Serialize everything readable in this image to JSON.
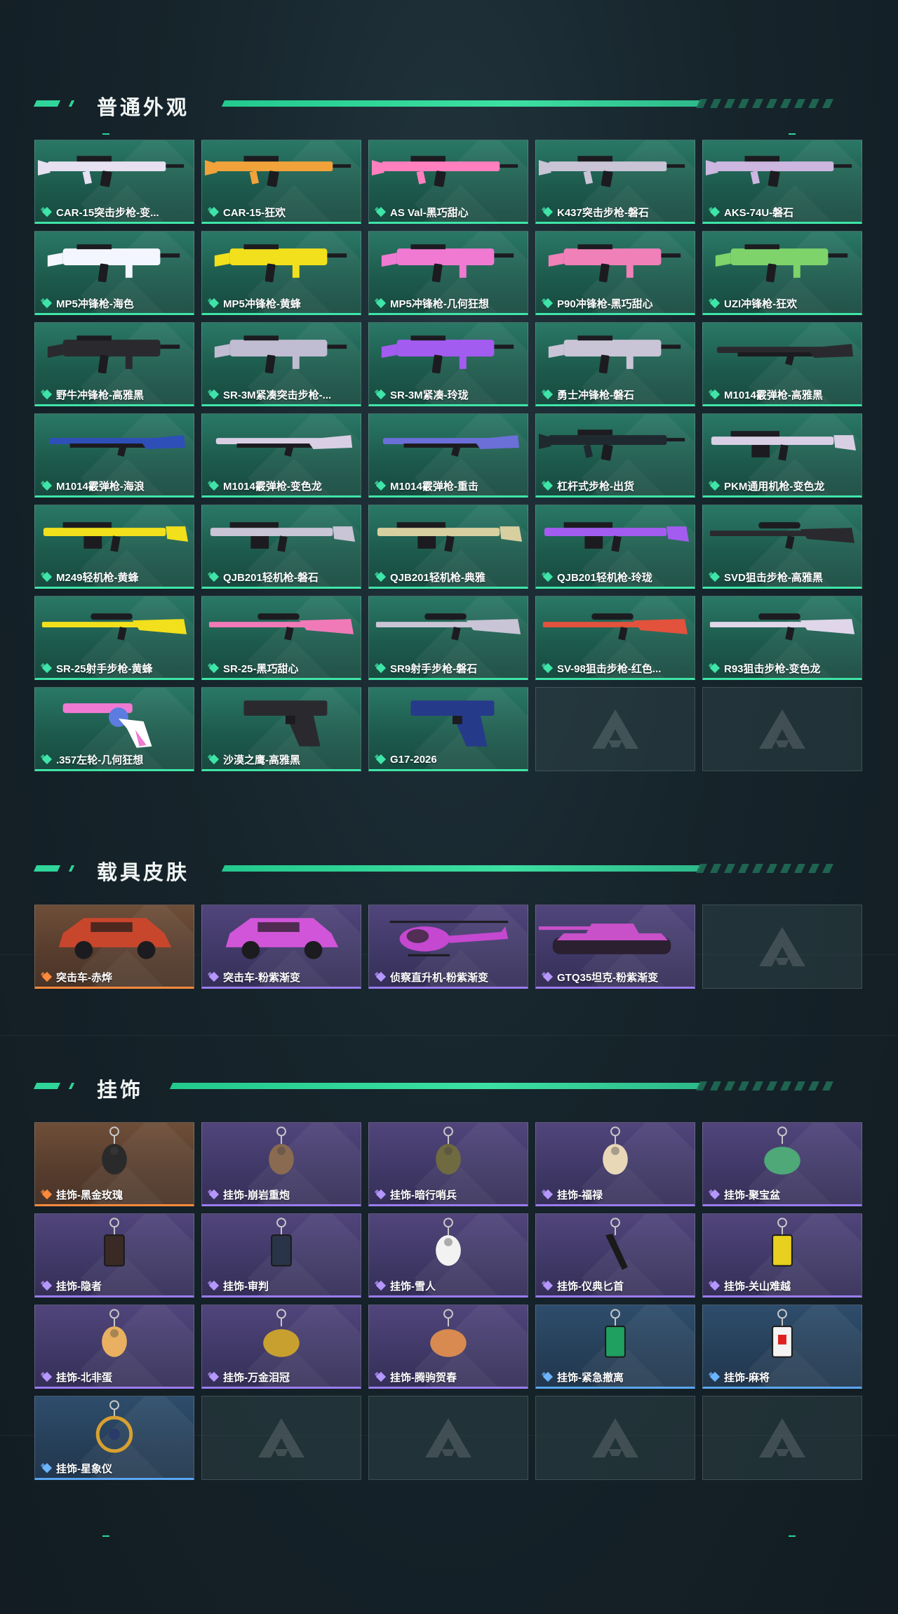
{
  "colors": {
    "accent": "#2fd59a",
    "green_card": "#1d5b4d",
    "purple_card": "#3f3866",
    "orange_card": "#563c2d",
    "blue_card": "#263f58"
  },
  "sections": [
    {
      "title": "普通外观",
      "items": [
        {
          "label": "CAR-15突击步枪-变...",
          "rarity": "green",
          "icon": "rifle-icon",
          "color": "#e6e0f0"
        },
        {
          "label": "CAR-15-狂欢",
          "rarity": "green",
          "icon": "rifle-icon",
          "color": "#f2a23a"
        },
        {
          "label": "AS Val-黑巧甜心",
          "rarity": "green",
          "icon": "rifle-icon",
          "color": "#ff7fbf"
        },
        {
          "label": "K437突击步枪-磐石",
          "rarity": "green",
          "icon": "rifle-icon",
          "color": "#c9c4d6"
        },
        {
          "label": "AKS-74U-磐石",
          "rarity": "green",
          "icon": "rifle-icon",
          "color": "#cdb6e0"
        },
        {
          "label": "MP5冲锋枪-海色",
          "rarity": "green",
          "icon": "smg-icon",
          "color": "#f4f6ff"
        },
        {
          "label": "MP5冲锋枪-黄蜂",
          "rarity": "green",
          "icon": "smg-icon",
          "color": "#f2e01c"
        },
        {
          "label": "MP5冲锋枪-几何狂想",
          "rarity": "green",
          "icon": "smg-icon",
          "color": "#f07ad2"
        },
        {
          "label": "P90冲锋枪-黑巧甜心",
          "rarity": "green",
          "icon": "smg-icon",
          "color": "#f080b8"
        },
        {
          "label": "UZI冲锋枪-狂欢",
          "rarity": "green",
          "icon": "smg-icon",
          "color": "#7ed36a"
        },
        {
          "label": "野牛冲锋枪-高雅黑",
          "rarity": "green",
          "icon": "smg-icon",
          "color": "#2a2a2e"
        },
        {
          "label": "SR-3M紧凑突击步枪-...",
          "rarity": "green",
          "icon": "smg-icon",
          "color": "#c0bcd2"
        },
        {
          "label": "SR-3M紧凑-玲珑",
          "rarity": "green",
          "icon": "smg-icon",
          "color": "#a35cf0"
        },
        {
          "label": "勇士冲锋枪-磐石",
          "rarity": "green",
          "icon": "smg-icon",
          "color": "#c9c4d6"
        },
        {
          "label": "M1014霰弹枪-高雅黑",
          "rarity": "green",
          "icon": "shotgun-icon",
          "color": "#2a2a2e"
        },
        {
          "label": "M1014霰弹枪-海浪",
          "rarity": "green",
          "icon": "shotgun-icon",
          "color": "#2e4fb8"
        },
        {
          "label": "M1014霰弹枪-变色龙",
          "rarity": "green",
          "icon": "shotgun-icon",
          "color": "#d9cfe4"
        },
        {
          "label": "M1014霰弹枪-重击",
          "rarity": "green",
          "icon": "shotgun-icon",
          "color": "#6b6fd8"
        },
        {
          "label": "杠杆式步枪-出货",
          "rarity": "green",
          "icon": "rifle-icon",
          "color": "#1f2a30"
        },
        {
          "label": "PKM通用机枪-变色龙",
          "rarity": "green",
          "icon": "machine-gun-icon",
          "color": "#d9cfe4"
        },
        {
          "label": "M249轻机枪-黄蜂",
          "rarity": "green",
          "icon": "machine-gun-icon",
          "color": "#f2e01c"
        },
        {
          "label": "QJB201轻机枪-磐石",
          "rarity": "green",
          "icon": "machine-gun-icon",
          "color": "#c9c4d6"
        },
        {
          "label": "QJB201轻机枪-典雅",
          "rarity": "green",
          "icon": "machine-gun-icon",
          "color": "#d8cfa0"
        },
        {
          "label": "QJB201轻机枪-玲珑",
          "rarity": "green",
          "icon": "machine-gun-icon",
          "color": "#a35cf0"
        },
        {
          "label": "SVD狙击步枪-高雅黑",
          "rarity": "green",
          "icon": "sniper-icon",
          "color": "#2a2a2e"
        },
        {
          "label": "SR-25射手步枪-黄蜂",
          "rarity": "green",
          "icon": "sniper-icon",
          "color": "#f2e01c"
        },
        {
          "label": "SR-25-黑巧甜心",
          "rarity": "green",
          "icon": "sniper-icon",
          "color": "#f07ab8"
        },
        {
          "label": "SR9射手步枪-磐石",
          "rarity": "green",
          "icon": "sniper-icon",
          "color": "#c9c4d6"
        },
        {
          "label": "SV-98狙击步枪-红色...",
          "rarity": "green",
          "icon": "sniper-icon",
          "color": "#e2523c"
        },
        {
          "label": "R93狙击步枪-变色龙",
          "rarity": "green",
          "icon": "sniper-icon",
          "color": "#e0d6ea"
        },
        {
          "label": ".357左轮-几何狂想",
          "rarity": "green",
          "icon": "revolver-icon",
          "color": "#f07ad2"
        },
        {
          "label": "沙漠之鹰-高雅黑",
          "rarity": "green",
          "icon": "pistol-icon",
          "color": "#2a2a2e"
        },
        {
          "label": "G17-2026",
          "rarity": "green",
          "icon": "pistol-icon",
          "color": "#263a8a"
        },
        {
          "label": "",
          "rarity": "empty",
          "icon": "placeholder-logo-icon",
          "color": ""
        },
        {
          "label": "",
          "rarity": "empty",
          "icon": "placeholder-logo-icon",
          "color": ""
        }
      ]
    },
    {
      "title": "载具皮肤",
      "items": [
        {
          "label": "突击车-赤烨",
          "rarity": "orange",
          "icon": "assault-vehicle-icon",
          "color": "#c8462c"
        },
        {
          "label": "突击车-粉紫渐变",
          "rarity": "purple",
          "icon": "assault-vehicle-icon",
          "color": "#d055d8"
        },
        {
          "label": "侦察直升机-粉紫渐变",
          "rarity": "purple",
          "icon": "helicopter-icon",
          "color": "#c448d0"
        },
        {
          "label": "GTQ35坦克-粉紫渐变",
          "rarity": "purple",
          "icon": "tank-icon",
          "color": "#c850c8"
        },
        {
          "label": "",
          "rarity": "empty",
          "icon": "placeholder-logo-icon",
          "color": ""
        }
      ]
    },
    {
      "title": "挂饰",
      "items": [
        {
          "label": "挂饰-黑金玫瑰",
          "rarity": "orange",
          "icon": "charm-rose-icon",
          "color": "#2a2a2a"
        },
        {
          "label": "挂饰-崩岩重炮",
          "rarity": "purple",
          "icon": "charm-figure-icon",
          "color": "#8a6a50"
        },
        {
          "label": "挂饰-暗行哨兵",
          "rarity": "purple",
          "icon": "charm-figure-icon",
          "color": "#6f6a40"
        },
        {
          "label": "挂饰-福禄",
          "rarity": "purple",
          "icon": "charm-gourd-icon",
          "color": "#e8d8b8"
        },
        {
          "label": "挂饰-聚宝盆",
          "rarity": "purple",
          "icon": "charm-treasure-icon",
          "color": "#4ea878"
        },
        {
          "label": "挂饰-隐者",
          "rarity": "purple",
          "icon": "charm-card-icon",
          "color": "#3a2a26"
        },
        {
          "label": "挂饰-审判",
          "rarity": "purple",
          "icon": "charm-card-icon",
          "color": "#2a3448"
        },
        {
          "label": "挂饰-雪人",
          "rarity": "purple",
          "icon": "charm-snowman-icon",
          "color": "#f2f2f2"
        },
        {
          "label": "挂饰-仪典匕首",
          "rarity": "purple",
          "icon": "charm-dagger-icon",
          "color": "#1a1a1a"
        },
        {
          "label": "挂饰-关山难越",
          "rarity": "purple",
          "icon": "charm-tag-icon",
          "color": "#e8d020"
        },
        {
          "label": "挂饰-北非蛋",
          "rarity": "purple",
          "icon": "charm-egg-icon",
          "color": "#e8b060"
        },
        {
          "label": "挂饰-万金泪冠",
          "rarity": "purple",
          "icon": "charm-crown-icon",
          "color": "#c8a030"
        },
        {
          "label": "挂饰-腾驹贺春",
          "rarity": "purple",
          "icon": "charm-carriage-icon",
          "color": "#d88a50"
        },
        {
          "label": "挂饰-紧急撤离",
          "rarity": "blue",
          "icon": "charm-sign-icon",
          "color": "#20a060"
        },
        {
          "label": "挂饰-麻将",
          "rarity": "blue",
          "icon": "charm-mahjong-icon",
          "color": "#f4f4f4"
        },
        {
          "label": "挂饰-星象仪",
          "rarity": "blue",
          "icon": "charm-astrolabe-icon",
          "color": "#d8a030"
        },
        {
          "label": "",
          "rarity": "empty",
          "icon": "placeholder-logo-icon",
          "color": ""
        },
        {
          "label": "",
          "rarity": "empty",
          "icon": "placeholder-logo-icon",
          "color": ""
        },
        {
          "label": "",
          "rarity": "empty",
          "icon": "placeholder-logo-icon",
          "color": ""
        },
        {
          "label": "",
          "rarity": "empty",
          "icon": "placeholder-logo-icon",
          "color": ""
        }
      ]
    }
  ]
}
